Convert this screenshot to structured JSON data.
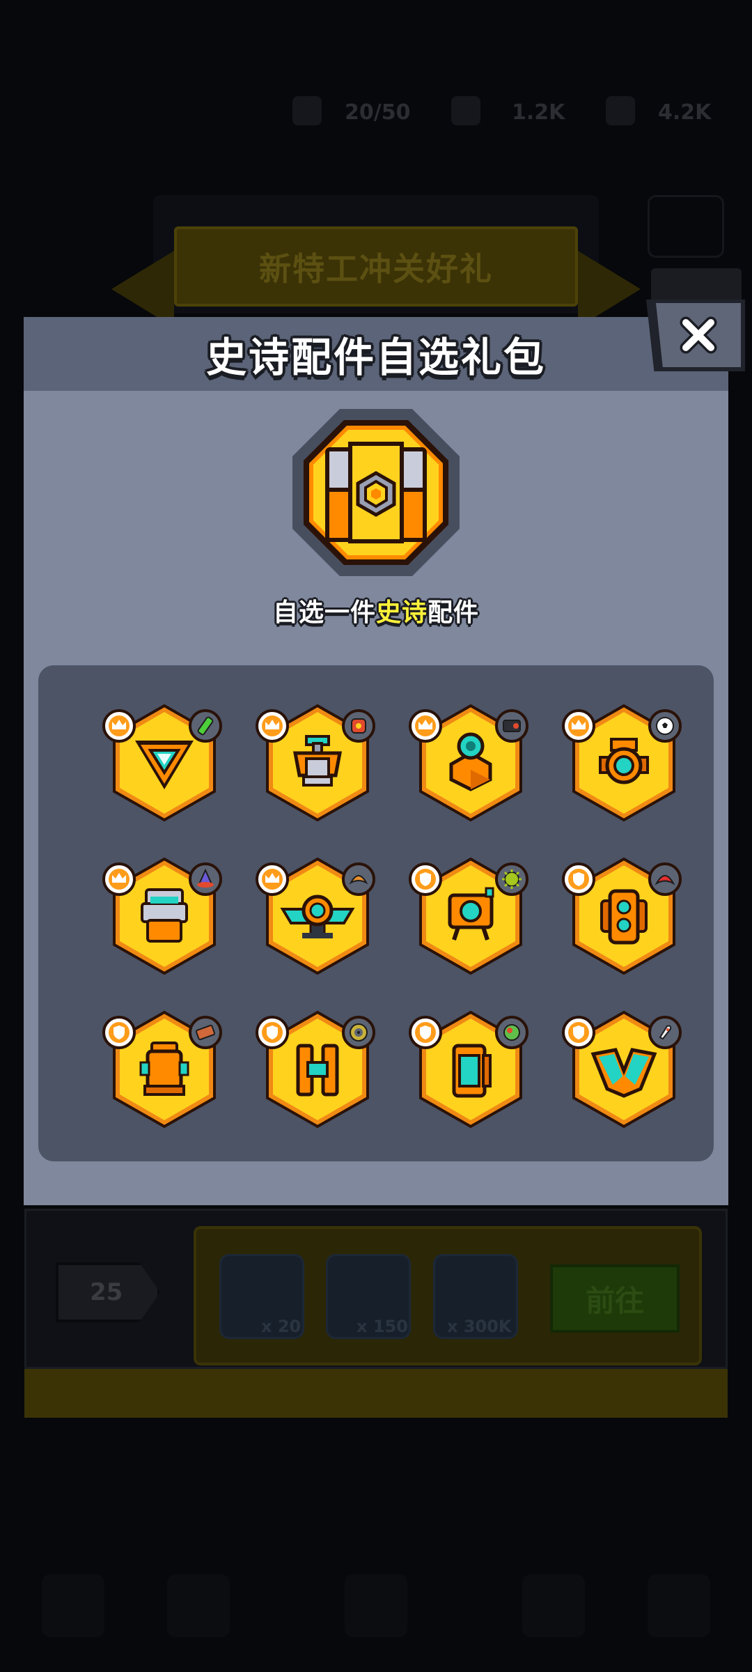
{
  "background": {
    "stats": [
      "20/50",
      "1.2K",
      "4.2K"
    ],
    "banner_title": "新特工冲关好礼",
    "level": "25",
    "rewards": [
      {
        "icon": "key-icon",
        "count": "x 20"
      },
      {
        "icon": "mystery-card-icon",
        "count": "x 150"
      },
      {
        "icon": "coin-icon",
        "count": "x 300K"
      }
    ],
    "go_button": "前往"
  },
  "popup": {
    "title": "史诗配件自选礼包",
    "subtitle_prefix": "自选一件",
    "subtitle_highlight": "史诗",
    "subtitle_suffix": "配件",
    "chest_icon": "epic-chest-icon",
    "close_icon": "close-icon"
  },
  "items": [
    {
      "type": "crown",
      "part": "triangle-module-icon",
      "badge": "green-bottle-icon"
    },
    {
      "type": "crown",
      "part": "sprayer-module-icon",
      "badge": "red-bag-icon"
    },
    {
      "type": "crown",
      "part": "lens-module-icon",
      "badge": "speaker-icon"
    },
    {
      "type": "crown",
      "part": "ring-emitter-icon",
      "badge": "soccer-ball-icon"
    },
    {
      "type": "crown",
      "part": "robot-head-icon",
      "badge": "wizard-hat-icon"
    },
    {
      "type": "crown",
      "part": "wing-turret-icon",
      "badge": "croissant-icon"
    },
    {
      "type": "shield",
      "part": "walker-drone-icon",
      "badge": "virus-icon"
    },
    {
      "type": "shield",
      "part": "twin-light-icon",
      "badge": "red-helmet-icon"
    },
    {
      "type": "shield",
      "part": "hydrant-icon",
      "badge": "brick-icon"
    },
    {
      "type": "shield",
      "part": "h-frame-icon",
      "badge": "target-icon"
    },
    {
      "type": "shield",
      "part": "side-shield-icon",
      "badge": "planet-icon"
    },
    {
      "type": "shield",
      "part": "v-armor-icon",
      "badge": "rocket-icon"
    }
  ],
  "colors": {
    "panel": "#7f889d",
    "header": "#5b6478",
    "grid": "#4c5466",
    "hex_fill": "#ffd21e",
    "hex_border": "#f08a14",
    "highlight": "#fff23a"
  }
}
